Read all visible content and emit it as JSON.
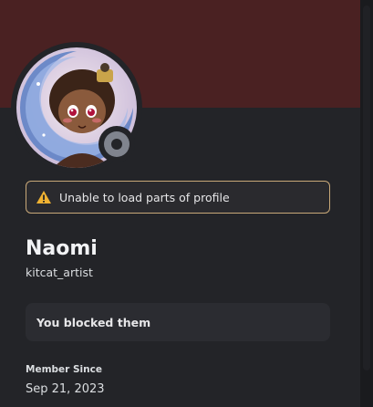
{
  "profile": {
    "display_name": "Naomi",
    "username": "kitcat_artist",
    "status": "offline",
    "avatar_icon": "avatar-image",
    "warning": {
      "icon": "warning-triangle-icon",
      "text": "Unable to load parts of profile"
    },
    "blocked_notice": "You blocked them",
    "member_since": {
      "label": "Member Since",
      "value": "Sep 21, 2023"
    }
  },
  "colors": {
    "banner": "#4a2122",
    "background": "#232428",
    "warning_border": "#c8a878",
    "warning_icon": "#f0b232",
    "status_offline": "#80848e"
  }
}
